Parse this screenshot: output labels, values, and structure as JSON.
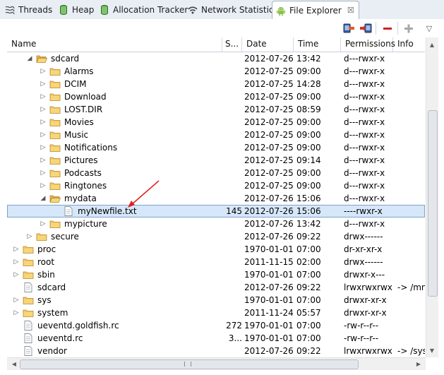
{
  "tabs": [
    {
      "label": "Threads",
      "icon": "threads-icon",
      "active": false
    },
    {
      "label": "Heap",
      "icon": "heap-cylinder-icon",
      "active": false
    },
    {
      "label": "Allocation Tracker",
      "icon": "allocation-cylinder-icon",
      "active": false
    },
    {
      "label": "Network Statistics",
      "icon": "wifi-icon",
      "active": false
    },
    {
      "label": "File Explorer",
      "icon": "android-icon",
      "active": true,
      "close": "☒"
    }
  ],
  "toolbar": {
    "pull_icon": "pull-file-from-device-icon",
    "push_icon": "push-file-onto-device-icon",
    "delete_label": "−",
    "new_folder_label": "+",
    "menu_label": "▽"
  },
  "columns": {
    "name": "Name",
    "size": "S...",
    "date": "Date",
    "time": "Time",
    "permissions": "Permissions",
    "info": "Info"
  },
  "rows": [
    {
      "name": "sdcard",
      "level": 1,
      "type": "folder",
      "expanded": true,
      "size": "",
      "date": "2012-07-26",
      "time": "13:42",
      "perm": "d---rwxr-x",
      "info": ""
    },
    {
      "name": "Alarms",
      "level": 2,
      "type": "folder",
      "expanded": false,
      "size": "",
      "date": "2012-07-25",
      "time": "09:00",
      "perm": "d---rwxr-x",
      "info": ""
    },
    {
      "name": "DCIM",
      "level": 2,
      "type": "folder",
      "expanded": false,
      "size": "",
      "date": "2012-07-25",
      "time": "14:28",
      "perm": "d---rwxr-x",
      "info": ""
    },
    {
      "name": "Download",
      "level": 2,
      "type": "folder",
      "expanded": false,
      "size": "",
      "date": "2012-07-25",
      "time": "09:00",
      "perm": "d---rwxr-x",
      "info": ""
    },
    {
      "name": "LOST.DIR",
      "level": 2,
      "type": "folder",
      "expanded": false,
      "size": "",
      "date": "2012-07-25",
      "time": "08:59",
      "perm": "d---rwxr-x",
      "info": ""
    },
    {
      "name": "Movies",
      "level": 2,
      "type": "folder",
      "expanded": false,
      "size": "",
      "date": "2012-07-25",
      "time": "09:00",
      "perm": "d---rwxr-x",
      "info": ""
    },
    {
      "name": "Music",
      "level": 2,
      "type": "folder",
      "expanded": false,
      "size": "",
      "date": "2012-07-25",
      "time": "09:00",
      "perm": "d---rwxr-x",
      "info": ""
    },
    {
      "name": "Notifications",
      "level": 2,
      "type": "folder",
      "expanded": false,
      "size": "",
      "date": "2012-07-25",
      "time": "09:00",
      "perm": "d---rwxr-x",
      "info": ""
    },
    {
      "name": "Pictures",
      "level": 2,
      "type": "folder",
      "expanded": false,
      "size": "",
      "date": "2012-07-25",
      "time": "09:14",
      "perm": "d---rwxr-x",
      "info": ""
    },
    {
      "name": "Podcasts",
      "level": 2,
      "type": "folder",
      "expanded": false,
      "size": "",
      "date": "2012-07-25",
      "time": "09:00",
      "perm": "d---rwxr-x",
      "info": ""
    },
    {
      "name": "Ringtones",
      "level": 2,
      "type": "folder",
      "expanded": false,
      "size": "",
      "date": "2012-07-25",
      "time": "09:00",
      "perm": "d---rwxr-x",
      "info": ""
    },
    {
      "name": "mydata",
      "level": 2,
      "type": "folder",
      "expanded": true,
      "size": "",
      "date": "2012-07-26",
      "time": "15:06",
      "perm": "d---rwxr-x",
      "info": ""
    },
    {
      "name": "myNewfile.txt",
      "level": 3,
      "type": "file",
      "selected": true,
      "size": "145",
      "date": "2012-07-26",
      "time": "15:06",
      "perm": "----rwxr-x",
      "info": ""
    },
    {
      "name": "mypicture",
      "level": 2,
      "type": "folder",
      "expanded": false,
      "size": "",
      "date": "2012-07-26",
      "time": "13:42",
      "perm": "d---rwxr-x",
      "info": ""
    },
    {
      "name": "secure",
      "level": 1,
      "type": "folder",
      "expanded": false,
      "size": "",
      "date": "2012-07-26",
      "time": "09:22",
      "perm": "drwx------",
      "info": ""
    },
    {
      "name": "proc",
      "level": 0,
      "type": "folder",
      "expanded": false,
      "size": "",
      "date": "1970-01-01",
      "time": "07:00",
      "perm": "dr-xr-xr-x",
      "info": ""
    },
    {
      "name": "root",
      "level": 0,
      "type": "folder",
      "expanded": false,
      "size": "",
      "date": "2011-11-15",
      "time": "02:00",
      "perm": "drwx------",
      "info": ""
    },
    {
      "name": "sbin",
      "level": 0,
      "type": "folder",
      "expanded": false,
      "size": "",
      "date": "1970-01-01",
      "time": "07:00",
      "perm": "drwxr-x---",
      "info": ""
    },
    {
      "name": "sdcard",
      "level": 0,
      "type": "file",
      "size": "",
      "date": "2012-07-26",
      "time": "09:22",
      "perm": "lrwxrwxrwx",
      "info": "-> /mn"
    },
    {
      "name": "sys",
      "level": 0,
      "type": "folder",
      "expanded": false,
      "size": "",
      "date": "1970-01-01",
      "time": "07:00",
      "perm": "drwxr-xr-x",
      "info": ""
    },
    {
      "name": "system",
      "level": 0,
      "type": "folder",
      "expanded": false,
      "size": "",
      "date": "2011-11-24",
      "time": "05:57",
      "perm": "drwxr-xr-x",
      "info": ""
    },
    {
      "name": "ueventd.goldfish.rc",
      "level": 0,
      "type": "file",
      "size": "272",
      "date": "1970-01-01",
      "time": "07:00",
      "perm": "-rw-r--r--",
      "info": ""
    },
    {
      "name": "ueventd.rc",
      "level": 0,
      "type": "file",
      "size": "3...",
      "date": "1970-01-01",
      "time": "07:00",
      "perm": "-rw-r--r--",
      "info": ""
    },
    {
      "name": "vendor",
      "level": 0,
      "type": "file",
      "size": "",
      "date": "2012-07-26",
      "time": "09:22",
      "perm": "lrwxrwxrwx",
      "info": "-> /syst"
    }
  ],
  "colors": {
    "tabbar_bg": "#e9eef5",
    "selected_row": "#d6e7f9",
    "folder": "#f3c965",
    "arrow": "#e02020",
    "delete": "#d42020"
  },
  "scroll": {
    "vertical_position_fraction": 0.55,
    "horizontal_position_fraction": 0.0
  }
}
